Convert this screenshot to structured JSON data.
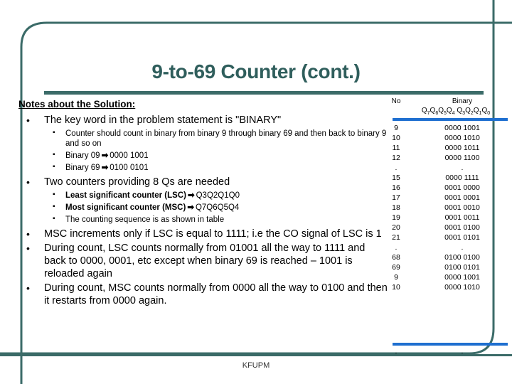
{
  "slide": {
    "title": "9-to-69 Counter (cont.)",
    "footer": "KFUPM"
  },
  "notes": {
    "heading": "Notes about the Solution:",
    "bullets": [
      {
        "text": "The key word in the problem statement is \"BINARY\"",
        "sub": [
          {
            "text": "Counter should count in binary from binary 9 through binary 69 and then back to binary 9 and so on"
          },
          {
            "label": "Binary 09",
            "arrow": "➡",
            "value": "0000 1001"
          },
          {
            "label": "Binary 69",
            "arrow": "➡",
            "value": "0100 0101"
          }
        ]
      },
      {
        "text": "Two counters providing 8 Qs are needed",
        "sub": [
          {
            "label": "Least significant counter  (LSC)",
            "arrow": "➡",
            "value": "Q3Q2Q1Q0",
            "bold": true
          },
          {
            "label": "Most significant  counter  (MSC)",
            "arrow": "➡",
            "value": "Q7Q6Q5Q4",
            "bold": true
          },
          {
            "text": "The counting sequence is as shown in table"
          }
        ]
      },
      {
        "text": "MSC increments only if LSC is equal to 1111; i.e the CO signal of LSC is 1",
        "sub": []
      },
      {
        "text": "During count, LSC counts normally from 01001 all the way to 1111 and back to 0000, 0001, etc except when binary 69 is reached – 1001 is reloaded again",
        "sub": []
      },
      {
        "text": "During count, MSC counts normally from 0000 all the way to 0100 and then it restarts from 0000 again.",
        "sub": []
      }
    ]
  },
  "table": {
    "header_no": "No",
    "header_binary": "Binary",
    "bit_labels_high": [
      "Q",
      "7",
      "Q",
      "6",
      "Q",
      "5",
      "Q",
      "4"
    ],
    "bit_labels_low": [
      "Q",
      "3",
      "Q",
      "2",
      "Q",
      "1",
      "Q",
      "0"
    ],
    "rows": [
      {
        "no": "9",
        "binary": "0000 1001"
      },
      {
        "no": "10",
        "binary": "0000 1010"
      },
      {
        "no": "11",
        "binary": "0000 1011"
      },
      {
        "no": "12",
        "binary": "0000 1100"
      },
      {
        "no": ".",
        "binary": "."
      },
      {
        "no": "15",
        "binary": "0000 1111"
      },
      {
        "no": "16",
        "binary": "0001 0000"
      },
      {
        "no": "17",
        "binary": "0001 0001"
      },
      {
        "no": "18",
        "binary": "0001 0010"
      },
      {
        "no": "19",
        "binary": "0001 0011"
      },
      {
        "no": "20",
        "binary": "0001 0100"
      },
      {
        "no": "21",
        "binary": "0001 0101"
      },
      {
        "no": ".",
        "binary": "."
      },
      {
        "no": "68",
        "binary": "0100 0100"
      },
      {
        "no": "69",
        "binary": "0100 0101"
      },
      {
        "no": "9",
        "binary": "0000 1001"
      },
      {
        "no": "10",
        "binary": "0000 1010"
      }
    ],
    "tail_no": ".",
    "tail_binary": "."
  },
  "colors": {
    "teal": "#2F5E5C",
    "teal_rule": "#3B6B68",
    "blue_rule": "#1F6FD0"
  }
}
